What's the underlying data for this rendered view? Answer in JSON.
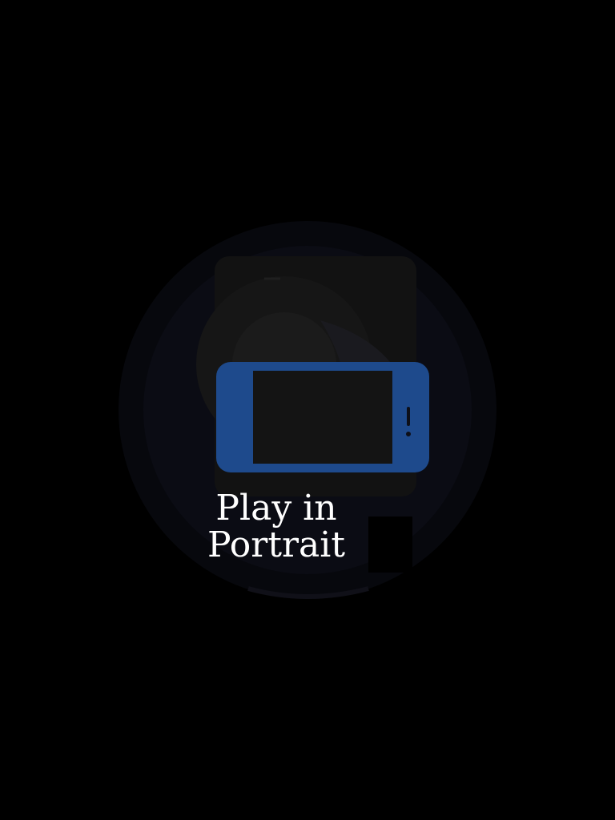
{
  "orientation_prompt": {
    "line1": "Play in",
    "line2": "Portrait"
  },
  "icons": {
    "background": "faded-game-logo-icon",
    "device": "rotate-to-portrait-phone-icon"
  },
  "colors": {
    "background": "#000000",
    "phone_body": "#1e4a8c",
    "phone_screen": "#141414",
    "text": "#ffffff",
    "faded_logo_ring": "#0b0d17",
    "faded_logo_fill": "#111111"
  }
}
